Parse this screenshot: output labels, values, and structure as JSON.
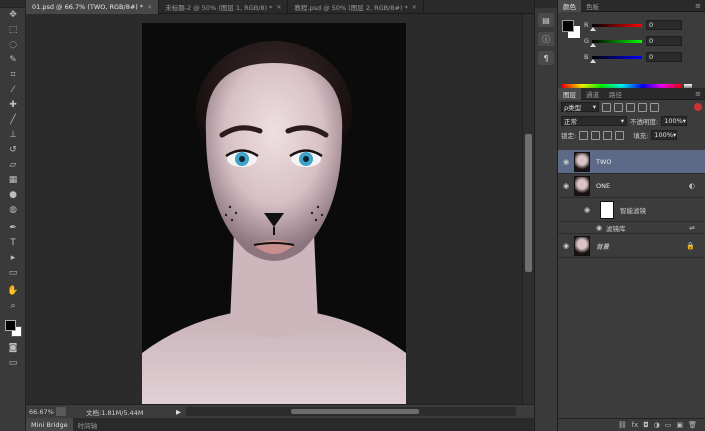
{
  "document_tabs": [
    {
      "label": "01.psd @ 66.7% (TWO, RGB/8#) *",
      "active": true
    },
    {
      "label": "未标题-2 @ 50% (图层 1, RGB/8) *",
      "active": false
    },
    {
      "label": "教程.psd @ 50% (图层 2, RGB/8#) *",
      "active": false
    }
  ],
  "tools": [
    "move-icon",
    "marquee-icon",
    "lasso-icon",
    "quick-select-icon",
    "crop-icon",
    "eyedropper-icon",
    "healing-icon",
    "brush-icon",
    "clone-stamp-icon",
    "history-brush-icon",
    "eraser-icon",
    "gradient-icon",
    "blur-icon",
    "dodge-icon",
    "pen-icon",
    "type-icon",
    "path-select-icon",
    "shape-icon",
    "hand-icon",
    "zoom-icon"
  ],
  "status": {
    "zoom": "66.67%",
    "doc_info": "文档:1.81M/5.44M",
    "arrow": "▶"
  },
  "bottom_tabs": [
    "Mini Bridge",
    "时间轴"
  ],
  "color_panel": {
    "tabs": [
      "颜色",
      "色板"
    ],
    "sliders": [
      {
        "label": "R",
        "value": "0",
        "gradient": "linear-gradient(to right,#000,#f00)"
      },
      {
        "label": "G",
        "value": "0",
        "gradient": "linear-gradient(to right,#000,#0f0)"
      },
      {
        "label": "B",
        "value": "0",
        "gradient": "linear-gradient(to right,#000,#00f)"
      }
    ],
    "foreground": "#000000",
    "background": "#ffffff"
  },
  "layers_panel": {
    "tabs": [
      "图层",
      "通道",
      "路径"
    ],
    "filter_kind": "ρ类型",
    "blend_mode": "正常",
    "opacity_label": "不透明度:",
    "opacity_value": "100%",
    "lock_label": "锁定:",
    "fill_label": "填充:",
    "fill_value": "100%",
    "layers": [
      {
        "name": "TWO",
        "selected": true
      },
      {
        "name": "ONE",
        "selected": false
      },
      {
        "name": "背景",
        "selected": false
      }
    ],
    "smart_filters_label": "智能滤镜",
    "filter_gallery_label": "滤镜库"
  }
}
